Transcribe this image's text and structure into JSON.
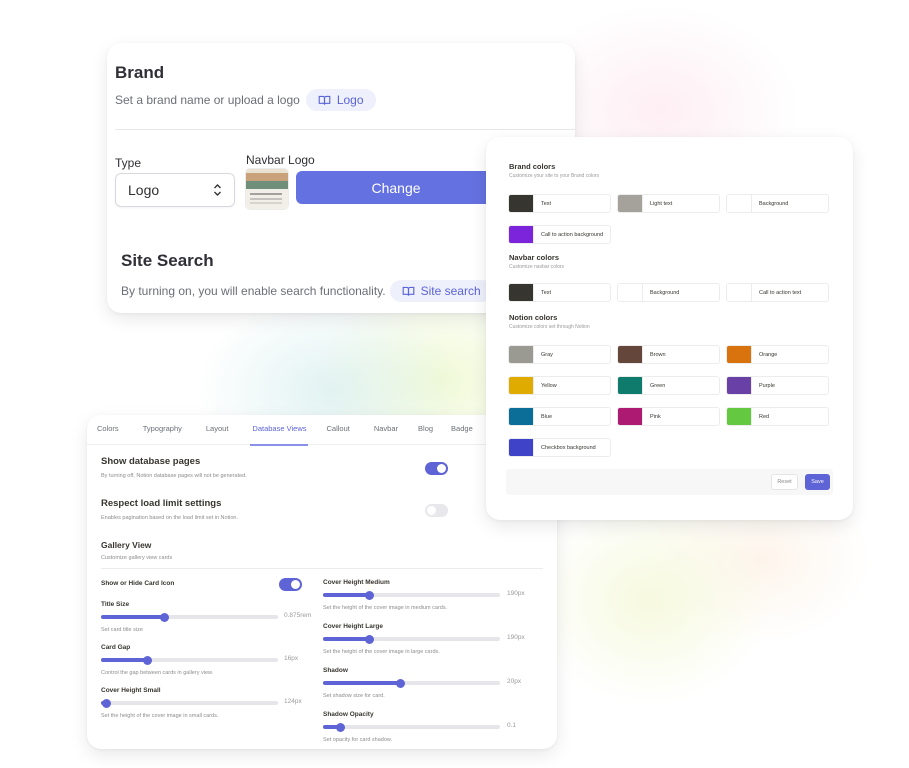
{
  "brand": {
    "title": "Brand",
    "subtitle": "Set a brand name or upload a logo",
    "logo_pill": "Logo",
    "type_label": "Type",
    "type_value": "Logo",
    "navbar_logo_label": "Navbar Logo",
    "change_button": "Change"
  },
  "site_search": {
    "title": "Site Search",
    "subtitle": "By turning on, you will enable search functionality.",
    "pill": "Site search"
  },
  "colors_panel": {
    "brand": {
      "title": "Brand colors",
      "subtitle": "Customize your site to your Brand colors",
      "items": [
        {
          "label": "Text",
          "color": "#37352f"
        },
        {
          "label": "Light text",
          "color": "#a5a29c"
        },
        {
          "label": "Background",
          "color": "#ffffff"
        },
        {
          "label": "Call to action background",
          "color": "#7b24dc"
        }
      ]
    },
    "navbar": {
      "title": "Navbar colors",
      "subtitle": "Customize navbar colors",
      "items": [
        {
          "label": "Text",
          "color": "#37352f"
        },
        {
          "label": "Background",
          "color": "#ffffff"
        },
        {
          "label": "Call to action text",
          "color": "#ffffff"
        }
      ]
    },
    "notion": {
      "title": "Notion colors",
      "subtitle": "Customize colors set through Notion",
      "items": [
        {
          "label": "Gray",
          "color": "#9b9a92"
        },
        {
          "label": "Brown",
          "color": "#64473a"
        },
        {
          "label": "Orange",
          "color": "#d9730d"
        },
        {
          "label": "Yellow",
          "color": "#dfab01"
        },
        {
          "label": "Green",
          "color": "#0f7b6c"
        },
        {
          "label": "Purple",
          "color": "#6940a5"
        },
        {
          "label": "Blue",
          "color": "#0b6e99"
        },
        {
          "label": "Pink",
          "color": "#ad1a72"
        },
        {
          "label": "Red",
          "color": "#64c840"
        },
        {
          "label": "Checkbox background",
          "color": "#3e43c8"
        }
      ]
    },
    "reset_button": "Reset",
    "save_button": "Save"
  },
  "settings": {
    "tabs": [
      {
        "label": "Colors",
        "active": false
      },
      {
        "label": "Typography",
        "active": false
      },
      {
        "label": "Layout",
        "active": false
      },
      {
        "label": "Database Views",
        "active": true
      },
      {
        "label": "Callout",
        "active": false
      },
      {
        "label": "Navbar",
        "active": false
      },
      {
        "label": "Blog",
        "active": false
      },
      {
        "label": "Badge",
        "active": false
      }
    ],
    "show_db_pages": {
      "title": "Show database pages",
      "desc": "By turning off, Notion database pages will not be generated.",
      "enabled": true
    },
    "respect_load_limit": {
      "title": "Respect load limit settings",
      "desc": "Enables pagination based on the load limit set in Notion.",
      "enabled": false
    },
    "gallery_view": {
      "title": "Gallery View",
      "subtitle": "Customize gallery view cards",
      "show_card_icon": {
        "label": "Show or Hide Card Icon",
        "enabled": true
      },
      "sliders_left": [
        {
          "label": "Title Size",
          "value": "0.875rem",
          "fraction": 0.36,
          "desc": "Set card title size"
        },
        {
          "label": "Card Gap",
          "value": "16px",
          "fraction": 0.26,
          "desc": "Control the gap between cards in gallery view."
        },
        {
          "label": "Cover Height Small",
          "value": "124px",
          "fraction": 0.03,
          "desc": "Set the height of the cover image in small cards."
        }
      ],
      "sliders_right": [
        {
          "label": "Cover Height Medium",
          "value": "190px",
          "fraction": 0.26,
          "desc": "Set the height of the cover image in medium cards."
        },
        {
          "label": "Cover Height Large",
          "value": "190px",
          "fraction": 0.26,
          "desc": "Set the height of the cover image in large cards."
        },
        {
          "label": "Shadow",
          "value": "20px",
          "fraction": 0.44,
          "desc": "Set shadow size for card."
        },
        {
          "label": "Shadow Opacity",
          "value": "0.1",
          "fraction": 0.1,
          "desc": "Set opacity for card shadow."
        }
      ]
    }
  }
}
